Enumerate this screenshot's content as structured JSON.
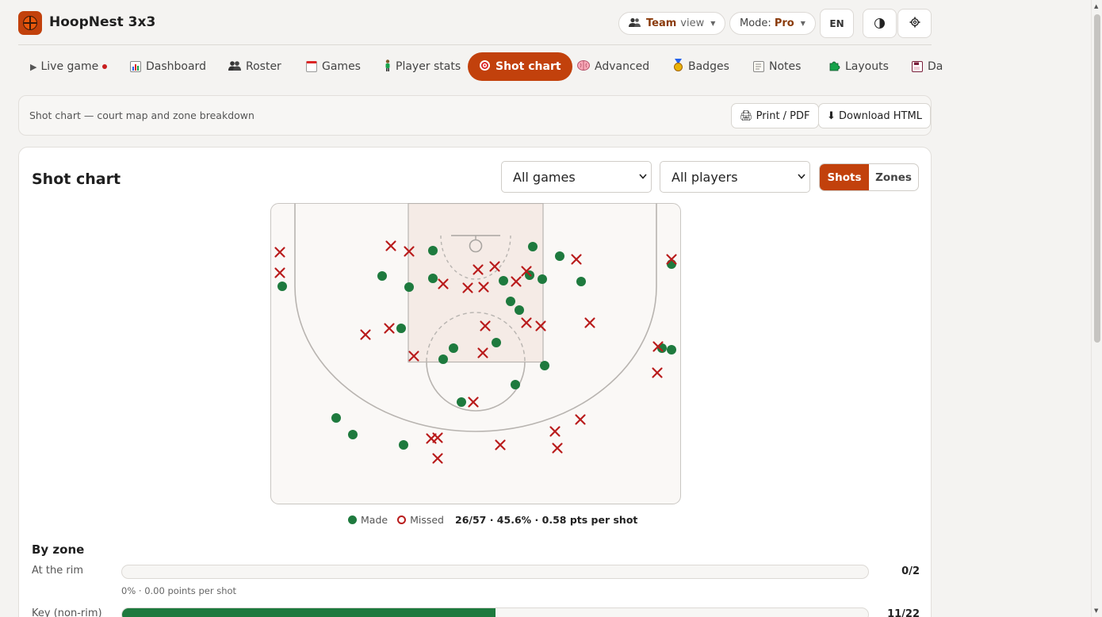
{
  "app": {
    "title": "HoopNest 3x3"
  },
  "header": {
    "view_label": "Team",
    "view_suffix": "view",
    "mode_label": "Mode:",
    "mode_value": "Pro",
    "lang": "EN"
  },
  "nav": {
    "tabs": [
      {
        "label": "Live game",
        "icon": "play-icon"
      },
      {
        "label": "Dashboard",
        "icon": "bar-chart-icon"
      },
      {
        "label": "Roster",
        "icon": "people-icon"
      },
      {
        "label": "Games",
        "icon": "calendar-icon"
      },
      {
        "label": "Player stats",
        "icon": "person-icon"
      },
      {
        "label": "Shot chart",
        "icon": "target-icon",
        "active": true
      },
      {
        "label": "Advanced",
        "icon": "brain-icon"
      },
      {
        "label": "Badges",
        "icon": "medal-icon"
      },
      {
        "label": "Notes",
        "icon": "memo-icon"
      },
      {
        "label": "Layouts",
        "icon": "puzzle-icon"
      },
      {
        "label": "Da",
        "icon": "floppy-icon"
      }
    ]
  },
  "toolbar": {
    "label": "Shot chart — court map and zone breakdown",
    "print": "🖨 Print / PDF",
    "download": "⬇ Download HTML"
  },
  "card": {
    "title": "Shot chart",
    "games_select": "All games",
    "players_select": "All players",
    "seg_shots": "Shots",
    "seg_zones": "Zones"
  },
  "legend": {
    "made": "Made",
    "missed": "Missed",
    "summary": "26/57 · 45.6% · 0.58 pts per shot"
  },
  "shots": {
    "made": [
      [
        15,
        105
      ],
      [
        205,
        60
      ],
      [
        141,
        92
      ],
      [
        175,
        106
      ],
      [
        205,
        95
      ],
      [
        331,
        55
      ],
      [
        365,
        67
      ],
      [
        392,
        99
      ],
      [
        294,
        98
      ],
      [
        343,
        96
      ],
      [
        327,
        91
      ],
      [
        303,
        124
      ],
      [
        314,
        135
      ],
      [
        165,
        158
      ],
      [
        231,
        183
      ],
      [
        218,
        197
      ],
      [
        285,
        176
      ],
      [
        346,
        205
      ],
      [
        309,
        229
      ],
      [
        241,
        251
      ],
      [
        83,
        271
      ],
      [
        104,
        292
      ],
      [
        168,
        305
      ],
      [
        494,
        183
      ],
      [
        506,
        185
      ],
      [
        506,
        77
      ]
    ],
    "missed": [
      [
        12,
        62
      ],
      [
        12,
        88
      ],
      [
        152,
        54
      ],
      [
        175,
        61
      ],
      [
        218,
        102
      ],
      [
        249,
        107
      ],
      [
        262,
        84
      ],
      [
        269,
        106
      ],
      [
        283,
        80
      ],
      [
        310,
        99
      ],
      [
        323,
        86
      ],
      [
        386,
        71
      ],
      [
        506,
        71
      ],
      [
        120,
        166
      ],
      [
        150,
        158
      ],
      [
        181,
        193
      ],
      [
        268,
        189
      ],
      [
        271,
        155
      ],
      [
        323,
        151
      ],
      [
        341,
        155
      ],
      [
        403,
        151
      ],
      [
        489,
        181
      ],
      [
        488,
        214
      ],
      [
        256,
        251
      ],
      [
        391,
        273
      ],
      [
        359,
        288
      ],
      [
        203,
        297
      ],
      [
        211,
        296
      ],
      [
        290,
        305
      ],
      [
        362,
        309
      ],
      [
        211,
        322
      ]
    ]
  },
  "zones": {
    "title": "By zone",
    "rows": [
      {
        "name": "At the rim",
        "made": 0,
        "att": 2,
        "value": "0/2",
        "sub": "0% · 0.00 points per shot"
      },
      {
        "name": "Key (non-rim)",
        "made": 11,
        "att": 22,
        "value": "11/22",
        "sub": ""
      }
    ]
  },
  "colors": {
    "accent": "#c2410c",
    "made": "#1e7a3e",
    "missed": "#b91c1c"
  }
}
